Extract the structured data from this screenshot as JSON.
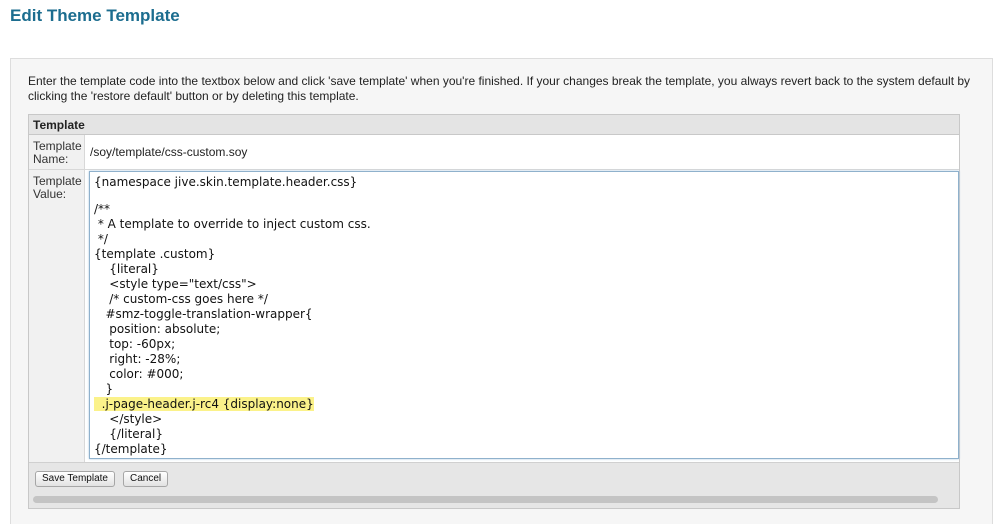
{
  "page": {
    "title": "Edit Theme Template"
  },
  "instructions": "Enter the template code into the textbox below and click 'save template' when you're finished. If your changes break the template, you always revert back to the system default by clicking the 'restore default' button or by deleting this template.",
  "table": {
    "header": "Template",
    "name_label": "Template Name:",
    "name_value": "/soy/template/css-custom.soy",
    "value_label": "Template Value:"
  },
  "code_lines": [
    "{namespace jive.skin.template.header.css}",
    "",
    "/**",
    " * A template to override to inject custom css.",
    " */",
    "{template .custom}",
    "    {literal}",
    "    <style type=\"text/css\">",
    "    /* custom-css goes here */",
    "   #smz-toggle-translation-wrapper{",
    "    position: absolute;",
    "    top: -60px;",
    "    right: -28%;",
    "    color: #000;",
    "   }",
    "  .j-page-header.j-rc4 {display:none}",
    "    </style>",
    "    {/literal}",
    "{/template}"
  ],
  "highlight_line_index": 15,
  "buttons": {
    "save": "Save Template",
    "cancel": "Cancel"
  },
  "colors": {
    "title": "#1c6d8f",
    "highlight": "#fbf28a"
  }
}
